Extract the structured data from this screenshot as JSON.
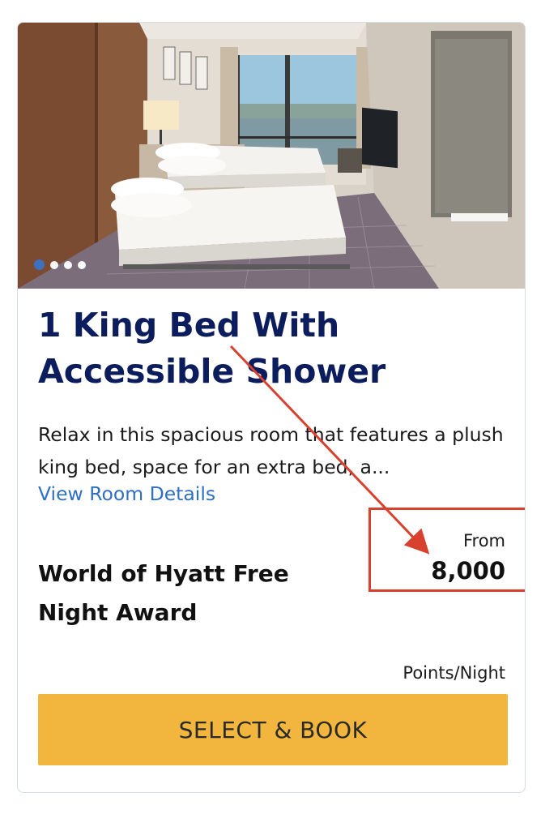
{
  "room": {
    "title": "1 King Bed With Accessible Shower",
    "description": "Relax in this spacious room that features a plush king bed, space for an extra bed, a...",
    "details_link": "View Room Details"
  },
  "carousel": {
    "slide_count": 4,
    "active_index": 0
  },
  "rate": {
    "name": "World of Hyatt Free Night Award",
    "from_label": "From",
    "price": "8,000",
    "unit": "Points/Night"
  },
  "actions": {
    "book_label": "SELECT & BOOK"
  },
  "colors": {
    "title": "#0c1d5e",
    "link": "#2f6fc3",
    "button": "#f2b63f",
    "annotation": "#d8412e",
    "active_dot": "#3a73c8"
  }
}
